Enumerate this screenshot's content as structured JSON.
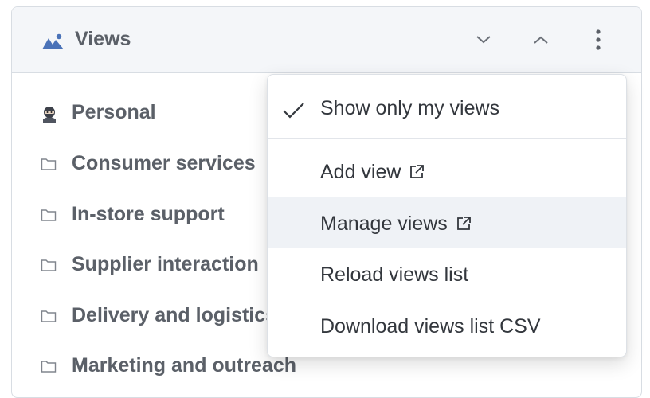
{
  "panel": {
    "title": "Views",
    "icon": "image-mountain-icon",
    "accent_color": "#4a72b8",
    "header_actions": [
      "chevron-down-icon",
      "chevron-up-icon",
      "kebab-menu-icon"
    ]
  },
  "views": [
    {
      "label": "Personal",
      "icon": "ninja-icon"
    },
    {
      "label": "Consumer services",
      "icon": "folder-icon"
    },
    {
      "label": "In-store support",
      "icon": "folder-icon"
    },
    {
      "label": "Supplier interaction",
      "icon": "folder-icon"
    },
    {
      "label": "Delivery and logistics",
      "icon": "folder-icon"
    },
    {
      "label": "Marketing and outreach",
      "icon": "folder-icon"
    }
  ],
  "menu": {
    "items": [
      {
        "label": "Show only my views",
        "checked": true
      },
      {
        "label": "Add view",
        "external": true
      },
      {
        "label": "Manage views",
        "external": true,
        "hovered": true
      },
      {
        "label": "Reload views list"
      },
      {
        "label": "Download views list CSV"
      }
    ]
  }
}
